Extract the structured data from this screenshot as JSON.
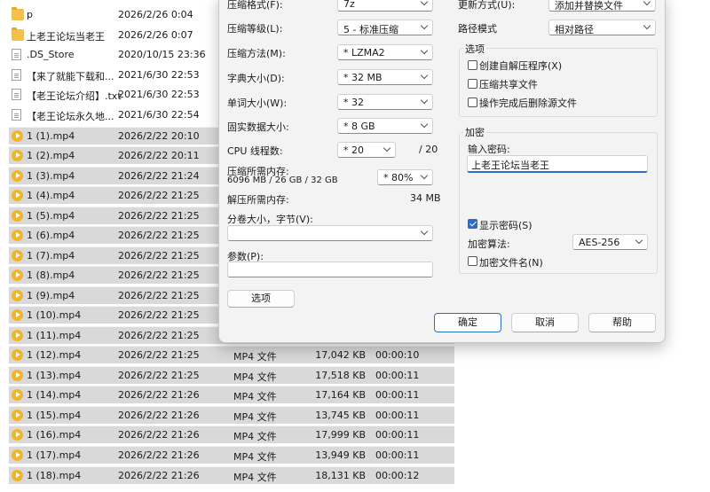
{
  "files": [
    {
      "icon": "folder",
      "name": "p",
      "date": "2026/2/26 0:04",
      "type": "",
      "size": "",
      "duration": "",
      "selected": false
    },
    {
      "icon": "folder",
      "name": "上老王论坛当老王",
      "date": "2026/2/26 0:07",
      "type": "",
      "size": "",
      "duration": "",
      "selected": false
    },
    {
      "icon": "file",
      "name": ".DS_Store",
      "date": "2020/10/15 23:36",
      "type": "",
      "size": "",
      "duration": "",
      "selected": false
    },
    {
      "icon": "file",
      "name": "【来了就能下载和...",
      "date": "2021/6/30 22:53",
      "type": "",
      "size": "",
      "duration": "",
      "selected": false
    },
    {
      "icon": "file",
      "name": "【老王论坛介绍】.txt",
      "date": "2021/6/30 22:53",
      "type": "",
      "size": "",
      "duration": "",
      "selected": false
    },
    {
      "icon": "file",
      "name": "【老王论坛永久地...",
      "date": "2021/6/30 22:54",
      "type": "",
      "size": "",
      "duration": "",
      "selected": false
    },
    {
      "icon": "mp4",
      "name": "1 (1).mp4",
      "date": "2026/2/22 20:10",
      "type": "",
      "size": "",
      "duration": "",
      "selected": true
    },
    {
      "icon": "mp4",
      "name": "1 (2).mp4",
      "date": "2026/2/22 20:11",
      "type": "",
      "size": "",
      "duration": "",
      "selected": true
    },
    {
      "icon": "mp4",
      "name": "1 (3).mp4",
      "date": "2026/2/22 21:24",
      "type": "",
      "size": "",
      "duration": "",
      "selected": true
    },
    {
      "icon": "mp4",
      "name": "1 (4).mp4",
      "date": "2026/2/22 21:25",
      "type": "",
      "size": "",
      "duration": "",
      "selected": true
    },
    {
      "icon": "mp4",
      "name": "1 (5).mp4",
      "date": "2026/2/22 21:25",
      "type": "",
      "size": "",
      "duration": "",
      "selected": true
    },
    {
      "icon": "mp4",
      "name": "1 (6).mp4",
      "date": "2026/2/22 21:25",
      "type": "",
      "size": "",
      "duration": "",
      "selected": true
    },
    {
      "icon": "mp4",
      "name": "1 (7).mp4",
      "date": "2026/2/22 21:25",
      "type": "",
      "size": "",
      "duration": "",
      "selected": true
    },
    {
      "icon": "mp4",
      "name": "1 (8).mp4",
      "date": "2026/2/22 21:25",
      "type": "",
      "size": "",
      "duration": "",
      "selected": true
    },
    {
      "icon": "mp4",
      "name": "1 (9).mp4",
      "date": "2026/2/22 21:25",
      "type": "",
      "size": "",
      "duration": "",
      "selected": true
    },
    {
      "icon": "mp4",
      "name": "1 (10).mp4",
      "date": "2026/2/22 21:25",
      "type": "",
      "size": "",
      "duration": "",
      "selected": true
    },
    {
      "icon": "mp4",
      "name": "1 (11).mp4",
      "date": "2026/2/22 21:25",
      "type": "",
      "size": "",
      "duration": "",
      "selected": true
    },
    {
      "icon": "mp4",
      "name": "1 (12).mp4",
      "date": "2026/2/22 21:25",
      "type": "MP4 文件",
      "size": "17,042 KB",
      "duration": "00:00:10",
      "selected": true
    },
    {
      "icon": "mp4",
      "name": "1 (13).mp4",
      "date": "2026/2/22 21:25",
      "type": "MP4 文件",
      "size": "17,518 KB",
      "duration": "00:00:11",
      "selected": true
    },
    {
      "icon": "mp4",
      "name": "1 (14).mp4",
      "date": "2026/2/22 21:26",
      "type": "MP4 文件",
      "size": "17,164 KB",
      "duration": "00:00:11",
      "selected": true
    },
    {
      "icon": "mp4",
      "name": "1 (15).mp4",
      "date": "2026/2/22 21:26",
      "type": "MP4 文件",
      "size": "13,745 KB",
      "duration": "00:00:11",
      "selected": true
    },
    {
      "icon": "mp4",
      "name": "1 (16).mp4",
      "date": "2026/2/22 21:26",
      "type": "MP4 文件",
      "size": "17,999 KB",
      "duration": "00:00:11",
      "selected": true
    },
    {
      "icon": "mp4",
      "name": "1 (17).mp4",
      "date": "2026/2/22 21:26",
      "type": "MP4 文件",
      "size": "13,949 KB",
      "duration": "00:00:11",
      "selected": true
    },
    {
      "icon": "mp4",
      "name": "1 (18).mp4",
      "date": "2026/2/22 21:26",
      "type": "MP4 文件",
      "size": "18,131 KB",
      "duration": "00:00:12",
      "selected": true
    }
  ],
  "dialog": {
    "format_label": "压缩格式(F):",
    "format_value": "7z",
    "level_label": "压缩等级(L):",
    "level_value": "5 - 标准压缩",
    "method_label": "压缩方法(M):",
    "method_value": "* LZMA2",
    "dict_label": "字典大小(D):",
    "dict_value": "* 32 MB",
    "word_label": "单词大小(W):",
    "word_value": "* 32",
    "solid_label": "固实数据大小:",
    "solid_value": "* 8 GB",
    "threads_label": "CPU 线程数:",
    "threads_value": "* 20",
    "threads_total": "/ 20",
    "mem_label": "压缩所需内存:",
    "mem_detail": "6096 MB / 26 GB / 32 GB",
    "mem_percent": "* 80%",
    "decomp_label": "解压所需内存:",
    "decomp_value": "34 MB",
    "split_label": "分卷大小，字节(V):",
    "split_value": "",
    "params_label": "参数(P):",
    "params_value": "",
    "options_button": "选项",
    "update_label": "更新方式(U):",
    "update_value": "添加并替换文件",
    "path_label": "路径模式",
    "path_value": "相对路径",
    "options_group": "选项",
    "opt_sfx": "创建自解压程序(X)",
    "opt_shared": "压缩共享文件",
    "opt_delete": "操作完成后删除源文件",
    "encrypt_group": "加密",
    "password_label": "输入密码:",
    "password_value": "上老王论坛当老王",
    "show_password": "显示密码(S)",
    "enc_method_label": "加密算法:",
    "enc_method_value": "AES-256",
    "encrypt_names": "加密文件名(N)",
    "ok": "确定",
    "cancel": "取消",
    "help": "帮助"
  },
  "colors": {
    "accent": "#2a6cc7",
    "selection": "#d9d9d9",
    "folder": "#f4c04a",
    "mp4": "#f2b624"
  }
}
